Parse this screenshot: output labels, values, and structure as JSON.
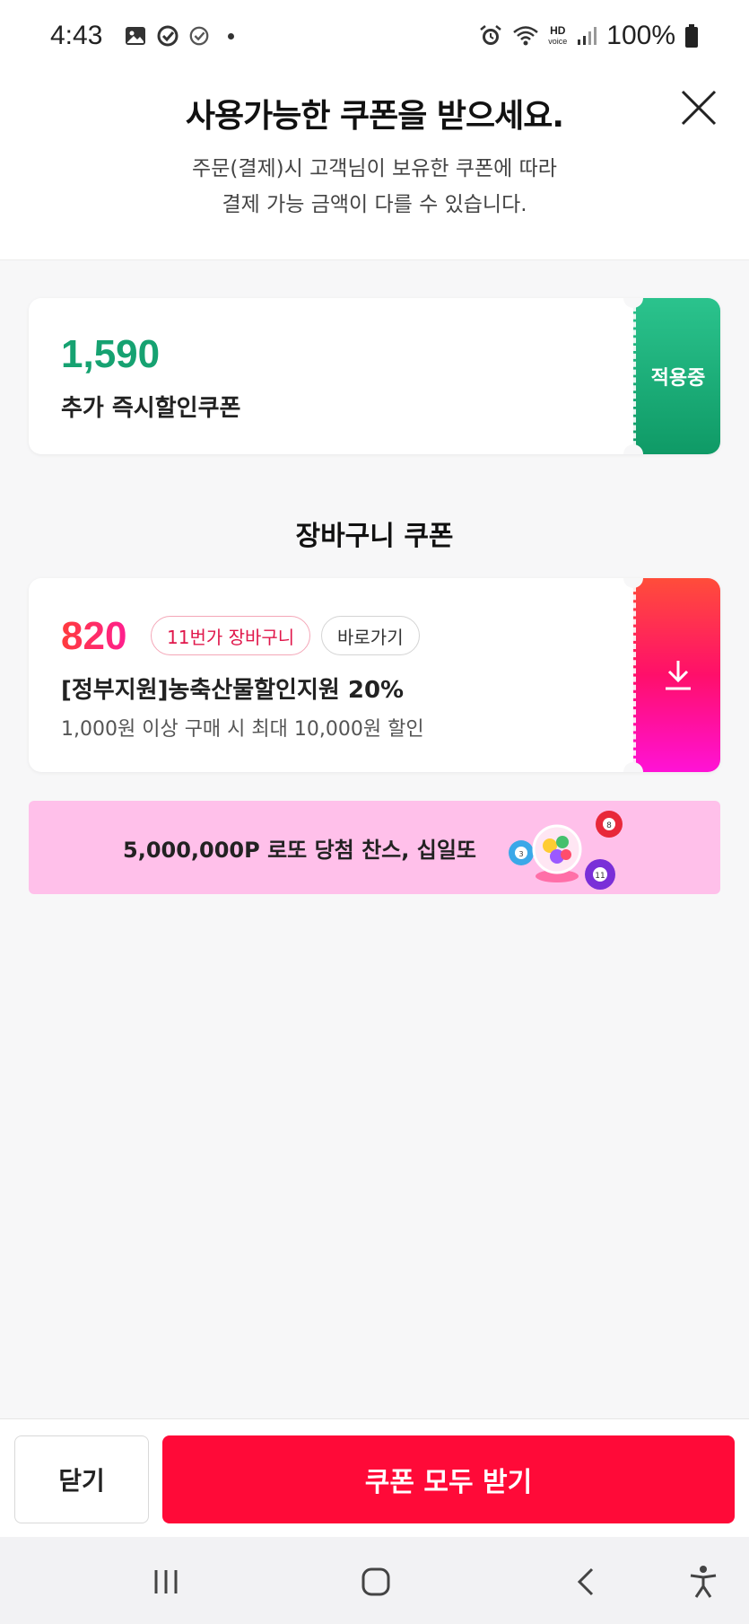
{
  "status_bar": {
    "time": "4:43",
    "battery": "100%",
    "icons": [
      "gallery-icon",
      "check-circle-icon",
      "check-circle-icon",
      "dot-icon",
      "alarm-icon",
      "wifi-icon",
      "hd-voice-icon",
      "signal-icon",
      "battery-icon"
    ],
    "hd_voice_top": "HD",
    "hd_voice_bottom": "voice"
  },
  "header": {
    "title": "사용가능한 쿠폰을 받으세요.",
    "subtitle_line1": "주문(결제)시 고객님이 보유한 쿠폰에 따라",
    "subtitle_line2": "결제 가능 금액이 다를 수 있습니다."
  },
  "applied_coupon": {
    "amount": "1,590",
    "name": "추가 즉시할인쿠폰",
    "status": "적용중",
    "accent": "#16a271"
  },
  "cart_section": {
    "title": "장바구니 쿠폰",
    "coupon": {
      "amount": "820",
      "tag": "11번가 장바구니",
      "link": "바로가기",
      "name": "[정부지원]농축산물할인지원 20%",
      "desc": "1,000원 이상 구매 시 최대 10,000원 할인",
      "action_icon": "download-icon"
    }
  },
  "banner": {
    "text": "5,000,000P 로또 당첨 찬스, 십일또",
    "ball_numbers": [
      "8",
      "3",
      "11"
    ],
    "background": "#ffc0ea"
  },
  "bottom": {
    "close_label": "닫기",
    "receive_all_label": "쿠폰 모두 받기",
    "accent": "#ff0a38"
  },
  "nav_bar": {
    "icons": [
      "recent-apps-icon",
      "home-icon",
      "back-icon",
      "accessibility-icon"
    ]
  }
}
